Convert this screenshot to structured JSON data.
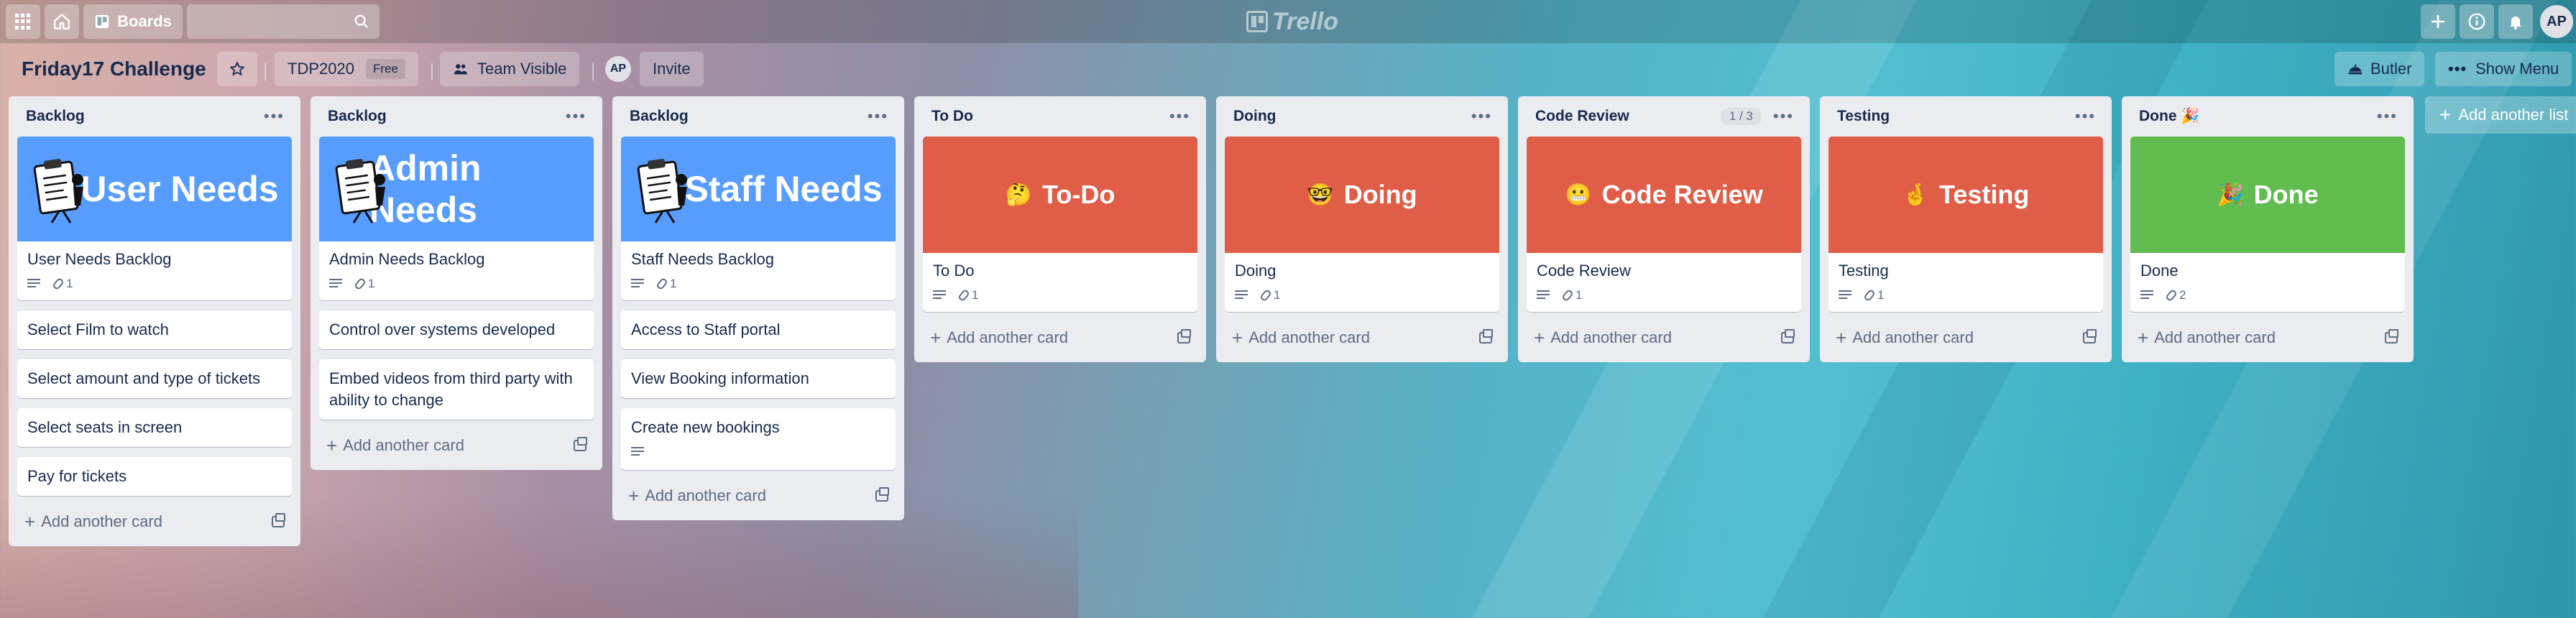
{
  "topbar": {
    "boards_label": "Boards",
    "logo_text": "Trello",
    "avatar": "AP",
    "search_value": ""
  },
  "board": {
    "title": "Friday17 Challenge",
    "team": "TDP2020",
    "team_badge": "Free",
    "visibility": "Team Visible",
    "member_avatar": "AP",
    "invite": "Invite",
    "butler": "Butler",
    "show_menu": "Show Menu"
  },
  "lists": [
    {
      "title": "Backlog",
      "cover": {
        "text": "User Needs",
        "color": "#579dff",
        "emoji": ""
      },
      "cover_title": "User Needs Backlog",
      "cover_attachments": "1",
      "cards": [
        "Select Film to watch",
        "Select amount and type of tickets",
        "Select seats in screen",
        "Pay for tickets"
      ],
      "add_card": "Add another card"
    },
    {
      "title": "Backlog",
      "cover": {
        "text": "Admin Needs",
        "color": "#579dff",
        "emoji": ""
      },
      "cover_title": "Admin Needs Backlog",
      "cover_attachments": "1",
      "cards": [
        "Control over systems developed",
        "Embed videos from third party with ability to change"
      ],
      "add_card": "Add another card"
    },
    {
      "title": "Backlog",
      "cover": {
        "text": "Staff Needs",
        "color": "#579dff",
        "emoji": ""
      },
      "cover_title": "Staff Needs Backlog",
      "cover_attachments": "1",
      "cards": [
        "Access to Staff portal",
        "View Booking information",
        "Create new bookings"
      ],
      "add_card": "Add another card"
    },
    {
      "title": "To Do",
      "cover": {
        "text": "To-Do",
        "color": "#e05d48",
        "emoji": "🤔"
      },
      "cover_title": "To Do",
      "cover_attachments": "1",
      "cards": [],
      "add_card": "Add another card"
    },
    {
      "title": "Doing",
      "cover": {
        "text": "Doing",
        "color": "#e05d48",
        "emoji": "🤓"
      },
      "cover_title": "Doing",
      "cover_attachments": "1",
      "cards": [],
      "add_card": "Add another card"
    },
    {
      "title": "Code Review",
      "count": "1 / 3",
      "cover": {
        "text": "Code Review",
        "color": "#e05d48",
        "emoji": "😬"
      },
      "cover_title": "Code Review",
      "cover_attachments": "1",
      "cards": [],
      "add_card": "Add another card"
    },
    {
      "title": "Testing",
      "cover": {
        "text": "Testing",
        "color": "#e05d48",
        "emoji": "🤞"
      },
      "cover_title": "Testing",
      "cover_attachments": "1",
      "cards": [],
      "add_card": "Add another card"
    },
    {
      "title": "Done 🎉",
      "cover": {
        "text": "Done",
        "color": "#61bd4f",
        "emoji": "🎉"
      },
      "cover_title": "Done",
      "cover_attachments": "2",
      "cards": [],
      "add_card": "Add another card"
    }
  ],
  "add_list": "Add another list"
}
